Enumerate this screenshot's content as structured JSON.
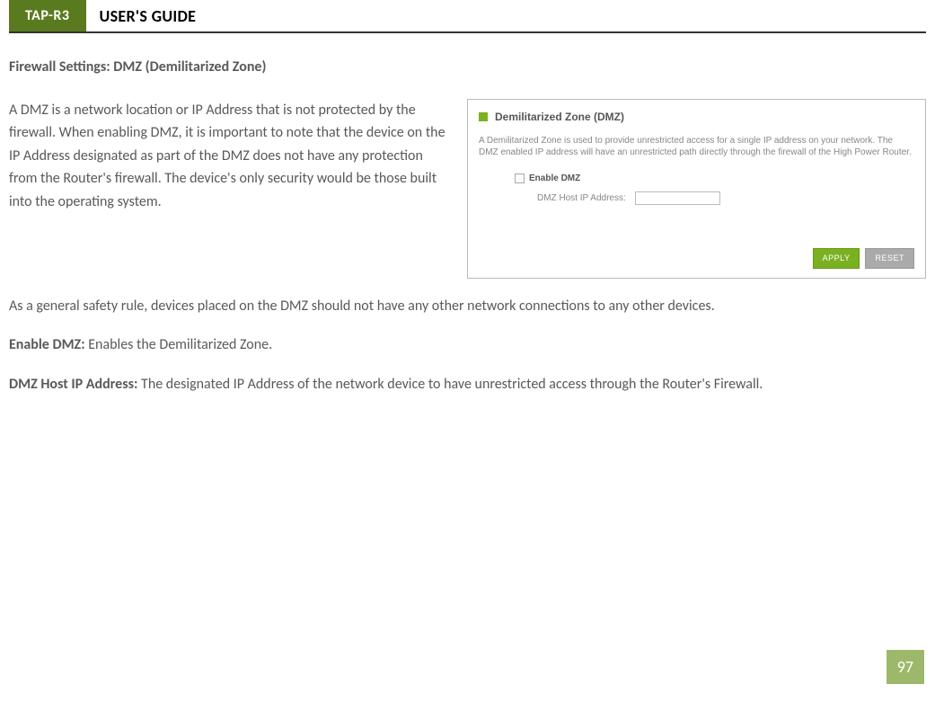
{
  "header": {
    "badge": "TAP-R3",
    "title": "USER'S GUIDE"
  },
  "section_title": "Firewall Settings: DMZ (Demilitarized Zone)",
  "intro_para": "A DMZ is a network location or IP Address that is not protected by the firewall.  When enabling DMZ, it is important to note that the device on the IP Address designated as part of the DMZ does not have any protection from the Router's firewall.  The device's only security would be those built into the operating system.",
  "safety_para": "As a general safety rule, devices placed on the DMZ should not have any other network connections to any other devices.",
  "defs": {
    "enable_label": "Enable DMZ:",
    "enable_text": " Enables the Demilitarized Zone.",
    "host_label": "DMZ Host IP Address:",
    "host_text": " The designated IP Address of the network device to have unrestricted access through the Router's Firewall."
  },
  "screenshot": {
    "title": "Demilitarized Zone (DMZ)",
    "desc": "A Demilitarized Zone is used to provide unrestricted access for a single IP address on your network. The DMZ enabled IP address will have an unrestricted path directly through the firewall of the High Power Router.",
    "checkbox_label": "Enable DMZ",
    "field_label": "DMZ Host IP Address:",
    "apply": "APPLY",
    "reset": "RESET"
  },
  "page_number": "97"
}
